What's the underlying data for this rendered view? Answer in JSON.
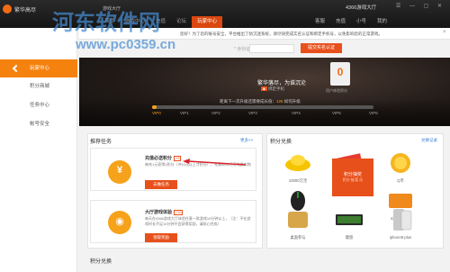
{
  "titlebar": {
    "app_name": "繁华高尽",
    "hall_label": "游戏大厅",
    "account": "4366游戏大厅",
    "window_controls": "☰ — ▢ ✕",
    "tabs": [
      {
        "label": "首页"
      },
      {
        "label": "游戏中心"
      },
      {
        "label": "充值"
      },
      {
        "label": "论坛"
      },
      {
        "label": "玩家中心"
      }
    ],
    "right_tabs": [
      {
        "label": "客服"
      },
      {
        "label": "充值"
      },
      {
        "label": "小号"
      },
      {
        "label": "我的"
      }
    ]
  },
  "notice": {
    "text": "您好！为了您的账号安全，平台推出了防沉迷系统，请尽快完成实名认证和绑定手机号，以免影响您的正常游戏。",
    "close": "×",
    "arrows": "◀▶"
  },
  "sidebar": {
    "items": [
      {
        "label": "玩家中心"
      },
      {
        "label": "积分商城"
      },
      {
        "label": "任务中心"
      },
      {
        "label": "帐号安全"
      }
    ]
  },
  "id_form": {
    "label": "* 身份证号",
    "button": "提交实名认证"
  },
  "profile": {
    "username": "繁华落尽，为谁沉沦",
    "bind_phone": "绑定手机",
    "bind_icon": "◙",
    "vip_level": "0",
    "vip_sub": "用户体验积分",
    "next_vip_prefix": "距离下一次升级还需要成长值：",
    "next_vip_value": "125",
    "next_vip_suffix": "如何升级",
    "vip_progress": 0.02,
    "vip_levels": [
      "VIP0",
      "VIP1",
      "VIP2",
      "VIP3",
      "VIP4",
      "VIP5",
      "VIP6"
    ]
  },
  "tasks": {
    "heading": "推荐任务",
    "more": "更多>>",
    "items": [
      {
        "title": "充值必送积分",
        "badge": "+5",
        "desc": "每充1元获得1积分（冲10元以上才积分），充满5000元可兑换实物",
        "button": "去做任务",
        "icon": "¥"
      },
      {
        "title": "大厅游戏体验",
        "badge": "+10",
        "desc": "每天在4366游戏大厅体验任意一款游戏10分钟以上，（注：不在游戏时长不足10分钟不会获得奖励，请耐心完成）",
        "button": "领取奖励",
        "icon": "◉"
      }
    ]
  },
  "exchange": {
    "heading": "积分兑换",
    "more": "兑换记录",
    "gifts": [
      {
        "name": "10000元宝"
      },
      {
        "name": "100元代金券"
      },
      {
        "name": "Q币"
      },
      {
        "name": "雷蛇鼠标"
      },
      {
        "name": "积分抽奖"
      },
      {
        "name": "4366积分卡"
      },
      {
        "name": "桌面参与"
      },
      {
        "name": "键盘"
      },
      {
        "name": "iphone8 plus"
      }
    ],
    "hot_label": "积分抽奖",
    "hot_sub": "积分 抽 奖 乐"
  },
  "watermark": {
    "line1": "河东软件网",
    "line2": "www.pc0359.cn"
  },
  "bottom": {
    "heading": "积分兑换"
  },
  "colors": {
    "accent": "#e8501b",
    "sidebar_active": "#f5820f",
    "link": "#3b7fd4"
  }
}
